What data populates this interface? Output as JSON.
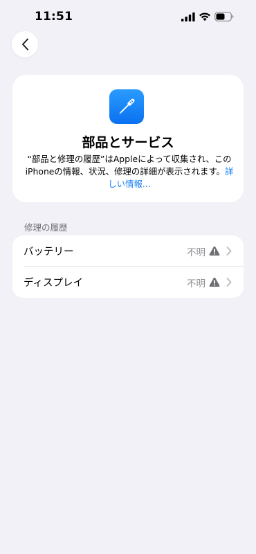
{
  "status_bar": {
    "time": "11:51",
    "icons": [
      "cellular-signal-icon",
      "wifi-icon",
      "battery-icon"
    ]
  },
  "nav": {
    "back_icon": "chevron-left-icon"
  },
  "header": {
    "icon": "screwdriver-icon",
    "icon_color": "#1a84f8",
    "title": "部品とサービス",
    "description": "“部品と修理の履歴”はAppleによって収集され、このiPhoneの情報、状況、修理の詳細が表示されます。",
    "learn_more": "詳しい情報..."
  },
  "section": {
    "label": "修理の履歴"
  },
  "items": [
    {
      "label": "バッテリー",
      "value": "不明",
      "icon": "warning-icon"
    },
    {
      "label": "ディスプレイ",
      "value": "不明",
      "icon": "warning-icon"
    }
  ],
  "colors": {
    "background": "#f2f1f7",
    "card": "#ffffff",
    "link": "#1a7ef2",
    "secondary_text": "#8e8e93"
  }
}
